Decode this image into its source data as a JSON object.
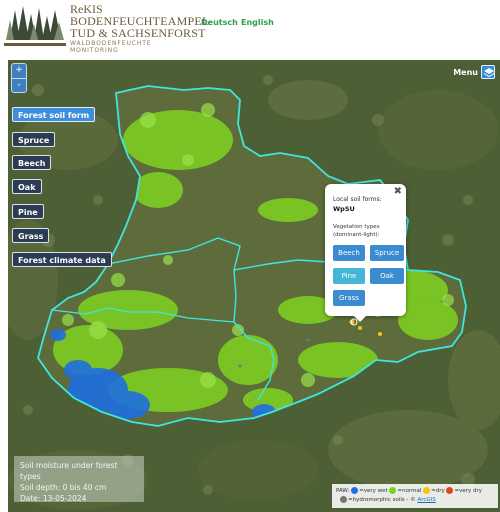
{
  "header": {
    "logo_line1": "ReKIS",
    "logo_line2": "BODENFEUCHTEAMPEL",
    "logo_line3": "TUD & SACHSENFORST",
    "logo_subtitle1": "WALDBODENFEUCHTE",
    "logo_subtitle2": "MONITORING",
    "lang_de": "Deutsch",
    "lang_en": "English"
  },
  "map": {
    "zoom_in": "+",
    "zoom_out": "-",
    "menu_label": "Menu",
    "layer_buttons": [
      {
        "label": "Forest soil form",
        "state": "active"
      },
      {
        "label": "Spruce",
        "state": "dark"
      },
      {
        "label": "Beech",
        "state": "dark"
      },
      {
        "label": "Oak",
        "state": "dark"
      },
      {
        "label": "Pine",
        "state": "dark"
      },
      {
        "label": "Grass",
        "state": "dark"
      },
      {
        "label": "Forest climate data",
        "state": "dark"
      }
    ],
    "popup": {
      "close": "✖",
      "soil_label": "Local soil forms:",
      "soil_value": "WpSU",
      "veg_label": "Vegetation types",
      "veg_sublabel": "(dominant-light):",
      "buttons": [
        "Beech",
        "Spruce",
        "Pine",
        "Oak",
        "Grass"
      ]
    },
    "info": {
      "line1": "Soil moisture under forest types",
      "line2": "Soil depth: 0 bis 40 cm",
      "line3": "Date: 13-05-2024"
    },
    "legend": {
      "prefix": "PAW:",
      "very_wet": "=very wet",
      "normal": "=normal",
      "dry": "=dry",
      "very_dry": "=very dry",
      "hydromorphic": "=hydromorphic soils",
      "sep": " - © ",
      "attribution": "ArcGIS",
      "colors": {
        "very_wet": "#1f6fe0",
        "normal": "#7ed321",
        "dry": "#f5c518",
        "very_dry": "#e0451f",
        "hydromorphic": "#777777"
      }
    }
  }
}
